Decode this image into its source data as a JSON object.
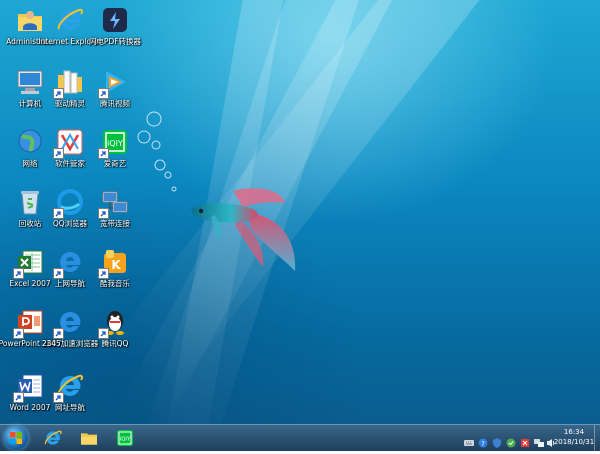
{
  "desktop": {
    "icons": [
      {
        "label": "Administra...",
        "icon": "user-folder-icon"
      },
      {
        "label": "Internet Explorer",
        "icon": "internet-explorer-icon"
      },
      {
        "label": "闪电PDF转换器",
        "icon": "pdf-converter-icon"
      },
      {
        "label": "计算机",
        "icon": "computer-icon"
      },
      {
        "label": "驱动精灵",
        "icon": "driver-genius-icon"
      },
      {
        "label": "腾讯视频",
        "icon": "tencent-video-icon"
      },
      {
        "label": "网络",
        "icon": "network-icon"
      },
      {
        "label": "软件管家",
        "icon": "software-manager-icon"
      },
      {
        "label": "爱奇艺",
        "icon": "iqiyi-icon"
      },
      {
        "label": "回收站",
        "icon": "recycle-bin-icon"
      },
      {
        "label": "QQ浏览器",
        "icon": "qq-browser-icon"
      },
      {
        "label": "宽带连接",
        "icon": "broadband-connection-icon"
      },
      {
        "label": "Excel 2007",
        "icon": "excel-icon"
      },
      {
        "label": "上网导航",
        "icon": "web-navigation-icon"
      },
      {
        "label": "酷我音乐",
        "icon": "kuwo-music-icon"
      },
      {
        "label": "PowerPoint 2007",
        "icon": "powerpoint-icon"
      },
      {
        "label": "2345加速浏览器",
        "icon": "browser-2345-icon"
      },
      {
        "label": "腾讯QQ",
        "icon": "qq-icon"
      },
      {
        "label": "Word 2007",
        "icon": "word-icon"
      },
      {
        "label": "网址导航",
        "icon": "url-navigation-icon"
      }
    ]
  },
  "taskbar": {
    "start_icon": "windows-start-icon",
    "pinned": [
      {
        "icon": "internet-explorer-icon"
      },
      {
        "icon": "file-explorer-icon"
      },
      {
        "icon": "iqiyi-icon"
      }
    ],
    "tray_icons": [
      "keyboard-icon",
      "help-icon",
      "shield-icon",
      "antivirus-icon",
      "flag-icon",
      "network-tray-icon",
      "volume-icon"
    ],
    "time": "16:34",
    "date": "2018/10/31"
  },
  "colors": {
    "wallpaper_top": "#1ea7d3",
    "wallpaper_bottom": "#0a5d8e",
    "taskbar": "#1d4a6e"
  }
}
